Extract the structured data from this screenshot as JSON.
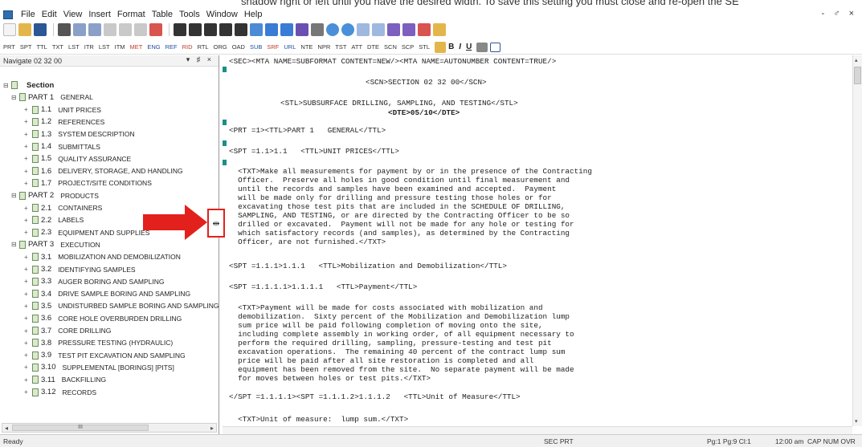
{
  "caption_text": "shadow right or left until you have the desired width. To save this setting you must close and re-open the SE",
  "menu": [
    "File",
    "Edit",
    "View",
    "Insert",
    "Format",
    "Table",
    "Tools",
    "Window",
    "Help"
  ],
  "window_controls": "- ♂ ×",
  "tag_toolbar": {
    "tags": [
      "PRT",
      "SPT",
      "TTL",
      "TXT",
      "LST",
      "ITR",
      "LST",
      "ITM",
      "MET",
      "ENG",
      "REF",
      "RID",
      "RTL",
      "ORG",
      "OAD",
      "SUB",
      "SRF",
      "URL",
      "NTE",
      "NPR",
      "TST",
      "ATT",
      "DTE",
      "SCN",
      "SCP",
      "STL"
    ],
    "format_buttons": [
      "B",
      "I",
      "U"
    ]
  },
  "nav": {
    "title": "Navigate 02 32 00",
    "controls": "▾ ♯ ×",
    "tree": [
      {
        "level": 0,
        "num": "",
        "label": "Section",
        "root": true
      },
      {
        "level": 1,
        "num": "PART 1",
        "label": "GENERAL"
      },
      {
        "level": 2,
        "num": "1.1",
        "label": "UNIT PRICES"
      },
      {
        "level": 2,
        "num": "1.2",
        "label": "REFERENCES"
      },
      {
        "level": 2,
        "num": "1.3",
        "label": "SYSTEM DESCRIPTION"
      },
      {
        "level": 2,
        "num": "1.4",
        "label": "SUBMITTALS"
      },
      {
        "level": 2,
        "num": "1.5",
        "label": "QUALITY ASSURANCE"
      },
      {
        "level": 2,
        "num": "1.6",
        "label": "DELIVERY, STORAGE, AND HANDLING"
      },
      {
        "level": 2,
        "num": "1.7",
        "label": "PROJECT/SITE CONDITIONS"
      },
      {
        "level": 1,
        "num": "PART 2",
        "label": "PRODUCTS"
      },
      {
        "level": 2,
        "num": "2.1",
        "label": "CONTAINERS"
      },
      {
        "level": 2,
        "num": "2.2",
        "label": "LABELS"
      },
      {
        "level": 2,
        "num": "2.3",
        "label": "EQUIPMENT AND SUPPLIES"
      },
      {
        "level": 1,
        "num": "PART 3",
        "label": "EXECUTION"
      },
      {
        "level": 2,
        "num": "3.1",
        "label": "MOBILIZATION AND DEMOBILIZATION"
      },
      {
        "level": 2,
        "num": "3.2",
        "label": "IDENTIFYING SAMPLES"
      },
      {
        "level": 2,
        "num": "3.3",
        "label": "AUGER BORING AND SAMPLING"
      },
      {
        "level": 2,
        "num": "3.4",
        "label": "DRIVE SAMPLE BORING AND SAMPLING"
      },
      {
        "level": 2,
        "num": "3.5",
        "label": "UNDISTURBED SAMPLE BORING AND SAMPLING"
      },
      {
        "level": 2,
        "num": "3.6",
        "label": "CORE HOLE OVERBURDEN DRILLING"
      },
      {
        "level": 2,
        "num": "3.7",
        "label": "CORE DRILLING"
      },
      {
        "level": 2,
        "num": "3.8",
        "label": "PRESSURE TESTING (HYDRAULIC)"
      },
      {
        "level": 2,
        "num": "3.9",
        "label": "TEST PIT EXCAVATION AND SAMPLING"
      },
      {
        "level": 2,
        "num": "3.10",
        "label": "SUPPLEMENTAL [BORINGS] [PITS]"
      },
      {
        "level": 2,
        "num": "3.11",
        "label": "BACKFILLING"
      },
      {
        "level": 2,
        "num": "3.12",
        "label": "RECORDS"
      }
    ],
    "scroll_thumb": "III"
  },
  "editor": {
    "lines": [
      "<SEC><MTA NAME=SUBFORMAT CONTENT=NEW/><MTA NAME=AUTONUMBER CONTENT=TRUE/>",
      "<SCN>SECTION 02 32 00</SCN>",
      "<STL>SUBSURFACE DRILLING, SAMPLING, AND TESTING</STL>",
      "<DTE>05/10</DTE>",
      "<PRT =1><TTL>PART 1   GENERAL</TTL>",
      "<SPT =1.1>1.1   <TTL>UNIT PRICES</TTL>",
      "  <TXT>Make all measurements for payment by or in the presence of the Contracting",
      "  Officer.  Preserve all holes in good condition until final measurement and",
      "  until the records and samples have been examined and accepted.  Payment",
      "  will be made only for drilling and pressure testing those holes or for",
      "  excavating those test pits that are included in the SCHEDULE OF DRILLING,",
      "  SAMPLING, AND TESTING, or are directed by the Contracting Officer to be so",
      "  drilled or excavated.  Payment will not be made for any hole or testing for",
      "  which satisfactory records (and samples), as determined by the Contracting",
      "  Officer, are not furnished.</TXT>",
      "<SPT =1.1.1>1.1.1   <TTL>Mobilization and Demobilization</TTL>",
      "<SPT =1.1.1.1>1.1.1.1   <TTL>Payment</TTL>",
      "  <TXT>Payment will be made for costs associated with mobilization and",
      "  demobilization.  Sixty percent of the Mobilization and Demobilization lump",
      "  sum price will be paid following completion of moving onto the site,",
      "  including complete assembly in working order, of all equipment necessary to",
      "  perform the required drilling, sampling, pressure-testing and test pit",
      "  excavation operations.  The remaining 40 percent of the contract lump sum",
      "  price will be paid after all site restoration is completed and all",
      "  equipment has been removed from the site.  No separate payment will be made",
      "  for moves between holes or test pits.</TXT>",
      "</SPT =1.1.1.1><SPT =1.1.1.2>1.1.1.2   <TTL>Unit of Measure</TTL>",
      "  <TXT>Unit of measure:  lump sum.</TXT>"
    ]
  },
  "status": {
    "left": "Ready",
    "element": "SEC PRT",
    "position": "Pg:1 Pg:9 Cl:1",
    "time": "12:00 am",
    "indicators": "CAP NUM OVR"
  },
  "colors": {
    "arrow": "#e2211c",
    "marker": "#1d8f89"
  }
}
